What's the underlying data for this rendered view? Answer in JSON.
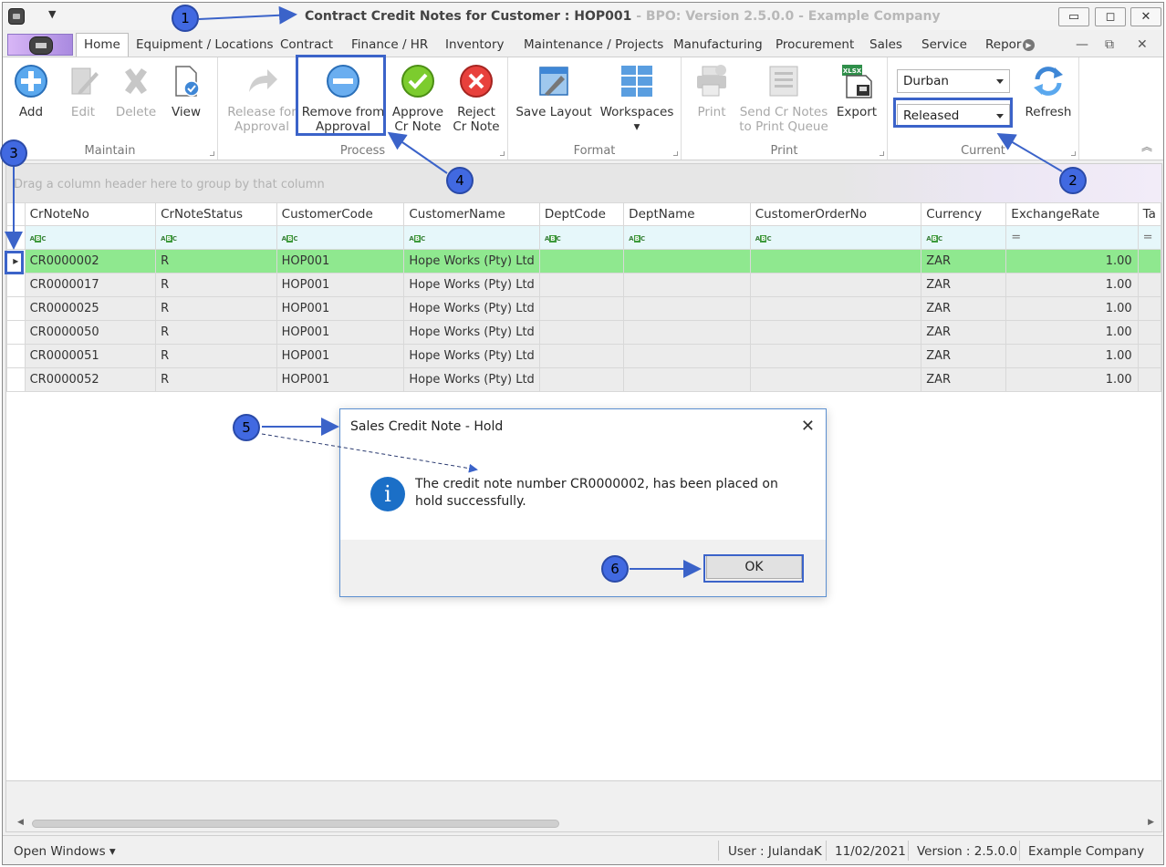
{
  "window": {
    "title_main": "Contract Credit Notes for Customer : HOP001",
    "title_suffix": " - BPO: Version 2.5.0.0 - Example Company",
    "minimize": "▭",
    "maximize": "◻",
    "close": "✕"
  },
  "tabs": [
    {
      "label": "Home"
    },
    {
      "label": "Equipment / Locations"
    },
    {
      "label": "Contract"
    },
    {
      "label": "Finance / HR"
    },
    {
      "label": "Inventory"
    },
    {
      "label": "Maintenance / Projects"
    },
    {
      "label": "Manufacturing"
    },
    {
      "label": "Procurement"
    },
    {
      "label": "Sales"
    },
    {
      "label": "Service"
    },
    {
      "label": "Repor"
    }
  ],
  "mdi_controls": {
    "minimize": "—",
    "restore": "⧉",
    "close": "✕"
  },
  "ribbon": {
    "maintain": {
      "label": "Maintain",
      "add": "Add",
      "edit": "Edit",
      "delete": "Delete",
      "view": "View"
    },
    "process": {
      "label": "Process",
      "release_line1": "Release for",
      "release_line2": "Approval",
      "remove_line1": "Remove from",
      "remove_line2": "Approval",
      "approve_line1": "Approve",
      "approve_line2": "Cr Note",
      "reject_line1": "Reject",
      "reject_line2": "Cr Note"
    },
    "format": {
      "label": "Format",
      "save_layout": "Save Layout",
      "workspaces": "Workspaces"
    },
    "print": {
      "label": "Print",
      "print": "Print",
      "send_line1": "Send Cr Notes",
      "send_line2": "to Print Queue",
      "export": "Export",
      "export_icon_text": "XLSX"
    },
    "current": {
      "label": "Current",
      "site": "Durban",
      "status": "Released",
      "refresh": "Refresh"
    }
  },
  "grid": {
    "group_panel": "Drag a column header here to group by that column",
    "columns": [
      "CrNoteNo",
      "CrNoteStatus",
      "CustomerCode",
      "CustomerName",
      "DeptCode",
      "DeptName",
      "CustomerOrderNo",
      "Currency",
      "ExchangeRate",
      "Ta"
    ],
    "filter_abc": "ABC",
    "filter_eq": "=",
    "rows": [
      {
        "CrNoteNo": "CR0000002",
        "CrNoteStatus": "R",
        "CustomerCode": "HOP001",
        "CustomerName": "Hope Works (Pty) Ltd",
        "DeptCode": "",
        "DeptName": "",
        "CustomerOrderNo": "",
        "Currency": "ZAR",
        "ExchangeRate": "1.00",
        "Ta": ""
      },
      {
        "CrNoteNo": "CR0000017",
        "CrNoteStatus": "R",
        "CustomerCode": "HOP001",
        "CustomerName": "Hope Works (Pty) Ltd",
        "DeptCode": "",
        "DeptName": "",
        "CustomerOrderNo": "",
        "Currency": "ZAR",
        "ExchangeRate": "1.00",
        "Ta": ""
      },
      {
        "CrNoteNo": "CR0000025",
        "CrNoteStatus": "R",
        "CustomerCode": "HOP001",
        "CustomerName": "Hope Works (Pty) Ltd",
        "DeptCode": "",
        "DeptName": "",
        "CustomerOrderNo": "",
        "Currency": "ZAR",
        "ExchangeRate": "1.00",
        "Ta": ""
      },
      {
        "CrNoteNo": "CR0000050",
        "CrNoteStatus": "R",
        "CustomerCode": "HOP001",
        "CustomerName": "Hope Works (Pty) Ltd",
        "DeptCode": "",
        "DeptName": "",
        "CustomerOrderNo": "",
        "Currency": "ZAR",
        "ExchangeRate": "1.00",
        "Ta": ""
      },
      {
        "CrNoteNo": "CR0000051",
        "CrNoteStatus": "R",
        "CustomerCode": "HOP001",
        "CustomerName": "Hope Works (Pty) Ltd",
        "DeptCode": "",
        "DeptName": "",
        "CustomerOrderNo": "",
        "Currency": "ZAR",
        "ExchangeRate": "1.00",
        "Ta": ""
      },
      {
        "CrNoteNo": "CR0000052",
        "CrNoteStatus": "R",
        "CustomerCode": "HOP001",
        "CustomerName": "Hope Works (Pty) Ltd",
        "DeptCode": "",
        "DeptName": "",
        "CustomerOrderNo": "",
        "Currency": "ZAR",
        "ExchangeRate": "1.00",
        "Ta": ""
      }
    ],
    "selected_row": 0
  },
  "dialog": {
    "title": "Sales Credit Note - Hold",
    "close": "✕",
    "icon": "i",
    "message": "The credit note number CR0000002, has been placed on hold successfully.",
    "ok": "OK"
  },
  "statusbar": {
    "open_windows": "Open Windows ▾",
    "user": "User : JulandaK",
    "date": "11/02/2021",
    "version": "Version : 2.5.0.0",
    "company": "Example Company"
  },
  "annotations": [
    "1",
    "2",
    "3",
    "4",
    "5",
    "6"
  ],
  "colors": {
    "selected_row": "#8fe88f",
    "annotation": "#4169e1",
    "dialog_border": "#5b8fd0"
  }
}
